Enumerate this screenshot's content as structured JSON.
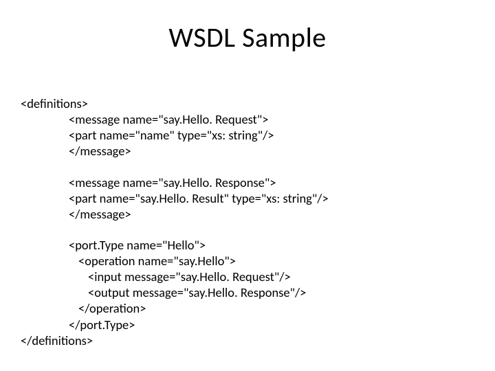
{
  "title": "WSDL Sample",
  "code": {
    "line01": "<definitions>",
    "line02": "<message name=\"say.Hello. Request\">",
    "line03": "<part name=\"name\" type=\"xs: string\"/>",
    "line04": "</message>",
    "line05": "<message name=\"say.Hello. Response\">",
    "line06": "<part name=\"say.Hello. Result\" type=\"xs: string\"/>",
    "line07": "</message>",
    "line08": "<port.Type name=\"Hello\">",
    "line09": "<operation name=\"say.Hello\">",
    "line10": "<input message=\"say.Hello. Request\"/>",
    "line11": "<output message=\"say.Hello. Response\"/>",
    "line12": "</operation>",
    "line13": "</port.Type>",
    "line14": "</definitions>"
  }
}
